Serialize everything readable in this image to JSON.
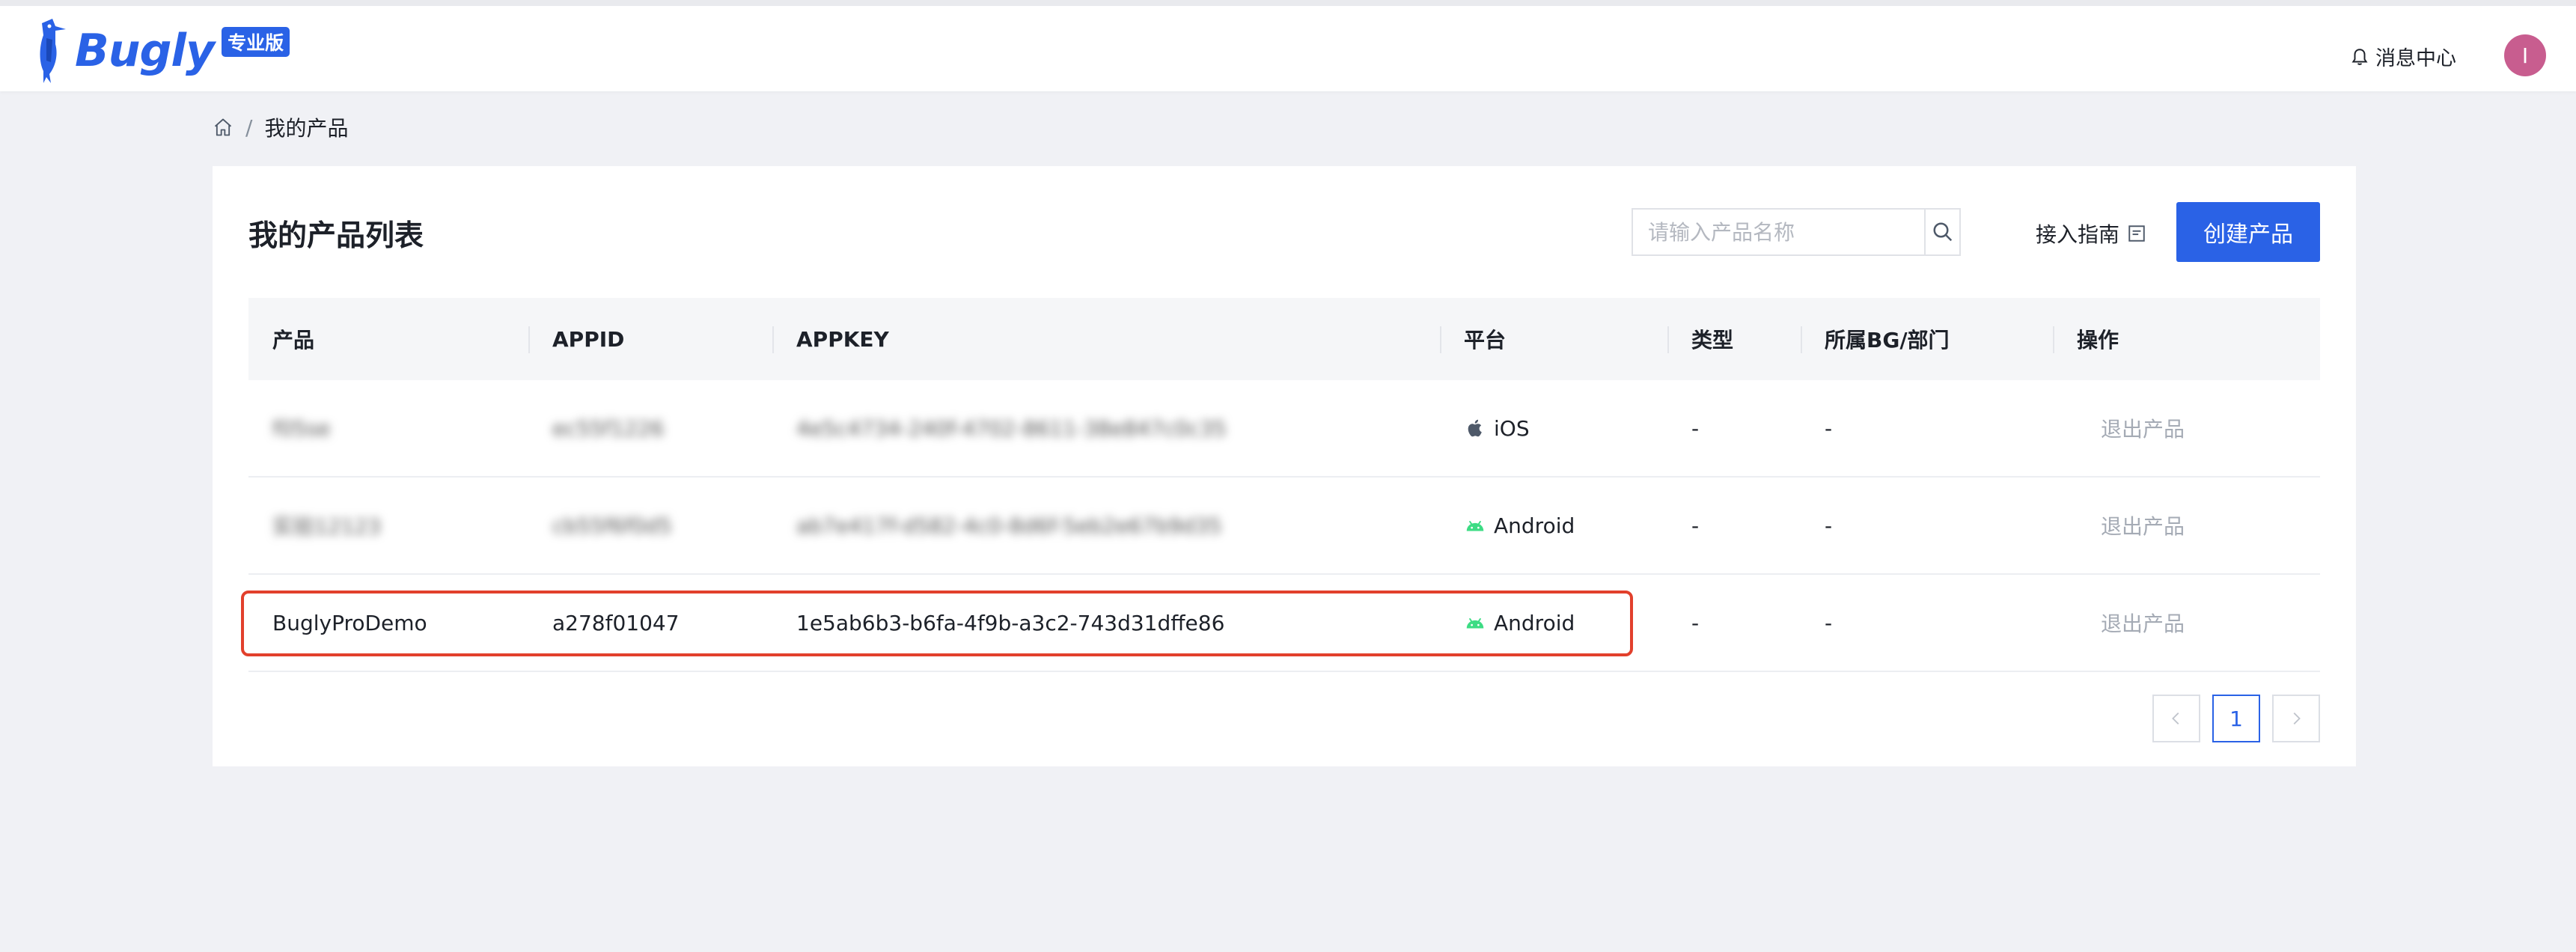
{
  "header": {
    "logo_text": "Bugly",
    "logo_badge": "专业版",
    "message_center": "消息中心",
    "avatar_initial": "I"
  },
  "breadcrumb": {
    "separator": "/",
    "current": "我的产品"
  },
  "main": {
    "title": "我的产品列表",
    "search": {
      "placeholder": "请输入产品名称",
      "value": ""
    },
    "guide_link": "接入指南",
    "create_button": "创建产品"
  },
  "table": {
    "columns": [
      "产品",
      "APPID",
      "APPKEY",
      "平台",
      "类型",
      "所属BG/部门",
      "操作"
    ],
    "rows": [
      {
        "product": "f05se",
        "appid": "ec55f1226",
        "appkey": "4e5c4734-240f-4702-8611-38e847c0c35",
        "platform": "iOS",
        "type": "-",
        "dept": "-",
        "action": "退出产品"
      },
      {
        "product": "实验12123",
        "appid": "cb55f6f0d5",
        "appkey": "ab7e417f-d582-4c0-8d6f-5eb2e67b9d35",
        "platform": "Android",
        "type": "-",
        "dept": "-",
        "action": "退出产品"
      },
      {
        "product": "BuglyProDemo",
        "appid": "a278f01047",
        "appkey": "1e5ab6b3-b6fa-4f9b-a3c2-743d31dffe86",
        "platform": "Android",
        "type": "-",
        "dept": "-",
        "action": "退出产品"
      }
    ]
  },
  "pagination": {
    "current": "1"
  },
  "colors": {
    "brand": "#2a62e6",
    "highlight": "#e2402c",
    "android": "#3ddc84"
  }
}
